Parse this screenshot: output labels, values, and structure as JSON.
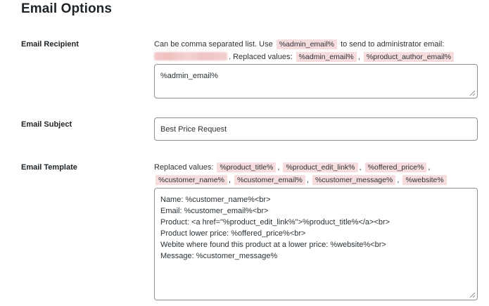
{
  "page": {
    "title": "Email Options"
  },
  "recipient": {
    "label": "Email Recipient",
    "desc_part1": "Can be comma separated list. Use",
    "desc_token_admin": "%admin_email%",
    "desc_part2": "to send to administrator email:",
    "desc_part3": ". Replaced values:",
    "replaced_tokens": [
      "%admin_email%",
      "%product_author_email%"
    ],
    "separator": ",",
    "value": "%admin_email%"
  },
  "subject": {
    "label": "Email Subject",
    "value": "Best Price Request"
  },
  "template": {
    "label": "Email Template",
    "desc_prefix": "Replaced values:",
    "replaced_tokens": [
      "%product_title%",
      "%product_edit_link%",
      "%offered_price%",
      "%customer_name%",
      "%customer_email%",
      "%customer_message%",
      "%website%"
    ],
    "separator": ",",
    "lines": [
      "Name: %customer_name%<br>",
      "Email: %customer_email%<br>",
      "Product: <a href=\"%product_edit_link%\">%product_title%</a><br>",
      "Product lower price: %offered_price%<br>",
      "Webite where found this product at a lower price: %website%<br>",
      "Message: %customer_message%"
    ]
  },
  "icons": {
    "resize_grip": "resize-grip-icon"
  },
  "colors": {
    "token_bg": "#f6dcdc",
    "border": "#8c8f94",
    "text": "#1d2327"
  }
}
